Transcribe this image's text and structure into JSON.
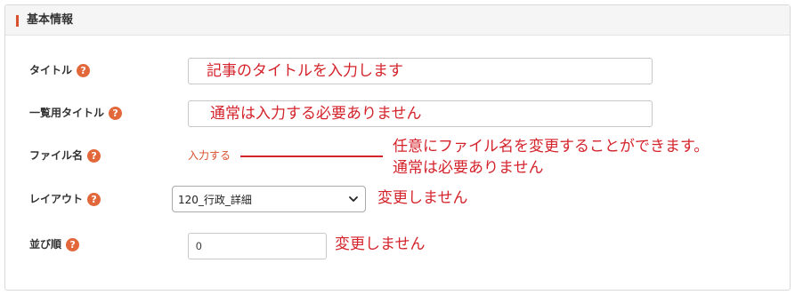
{
  "section": {
    "title": "基本情報"
  },
  "fields": {
    "title": {
      "label": "タイトル",
      "value": ""
    },
    "list_title": {
      "label": "一覧用タイトル",
      "value": ""
    },
    "filename": {
      "label": "ファイル名",
      "link_text": "入力する"
    },
    "layout": {
      "label": "レイアウト",
      "selected": "120_行政_詳細"
    },
    "order": {
      "label": "並び順",
      "value": "0"
    }
  },
  "help_icon_glyph": "?",
  "annotations": {
    "title_note": "記事のタイトルを入力します",
    "list_title_note": "通常は入力する必要ありません",
    "filename_note_line1": "任意にファイル名を変更することができます。",
    "filename_note_line2": "通常は必要ありません",
    "layout_note": "変更しません",
    "order_note": "変更しません"
  },
  "colors": {
    "accent": "#e2673a",
    "annotation": "#d4232b"
  }
}
